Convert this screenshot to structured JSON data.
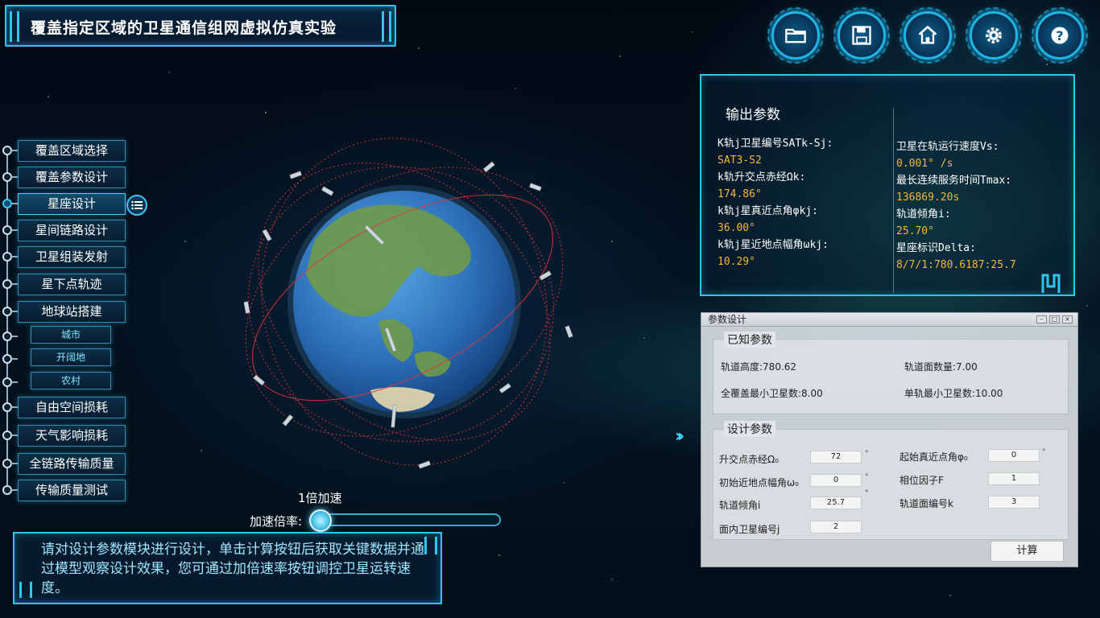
{
  "app": {
    "title": "覆盖指定区域的卫星通信组网虚拟仿真实验"
  },
  "toolbar": {
    "buttons": [
      {
        "name": "open-folder-button",
        "icon": "folder-icon"
      },
      {
        "name": "save-button",
        "icon": "save-icon"
      },
      {
        "name": "home-button",
        "icon": "home-icon"
      },
      {
        "name": "settings-button",
        "icon": "gear-icon"
      },
      {
        "name": "help-button",
        "icon": "help-icon"
      }
    ]
  },
  "menu": {
    "items": [
      {
        "label": "覆盖区域选择"
      },
      {
        "label": "覆盖参数设计"
      },
      {
        "label": "星座设计",
        "active": true
      },
      {
        "label": "星间链路设计"
      },
      {
        "label": "卫星组装发射"
      },
      {
        "label": "星下点轨迹"
      },
      {
        "label": "地球站搭建"
      },
      {
        "label": "城市",
        "sub": true
      },
      {
        "label": "开阔地",
        "sub": true
      },
      {
        "label": "农村",
        "sub": true
      },
      {
        "label": "自由空间损耗"
      },
      {
        "label": "天气影响损耗"
      },
      {
        "label": "全链路传输质量"
      },
      {
        "label": "传输质量测试"
      }
    ]
  },
  "speed": {
    "caption": "1倍加速",
    "label": "加速倍率:",
    "level": 0.0
  },
  "hint": {
    "text": "请对设计参数模块进行设计，单击计算按钮后获取关键数据并通过模型观察设计效果，您可通过加倍速率按钮调控卫星运转速度。"
  },
  "output": {
    "title": "输出参数",
    "left": [
      {
        "label": "K轨j卫星编号SATk-Sj:",
        "value": "SAT3-S2"
      },
      {
        "label": "k轨升交点赤经Ωk:",
        "value": "174.86°"
      },
      {
        "label": "k轨j星真近点角φkj:",
        "value": "36.00°"
      },
      {
        "label": "k轨j星近地点幅角ωkj:",
        "value": "10.29°"
      }
    ],
    "right": [
      {
        "label": "卫星在轨运行速度Vs:",
        "value": "0.001° /s"
      },
      {
        "label": "最长连续服务时间Tmax:",
        "value": "136869.20s"
      },
      {
        "label": "轨道倾角i:",
        "value": "25.70°"
      },
      {
        "label": "星座标识Delta:",
        "value": "8/7/1:780.6187:25.7"
      }
    ]
  },
  "design": {
    "window_title": "参数设计",
    "known": {
      "title": "已知参数",
      "orbit_height": "轨道高度:780.62",
      "orbit_planes": "轨道面数量:7.00",
      "min_sats_total": "全覆盖最小卫星数:8.00",
      "min_sats_per_orbit": "单轨最小卫星数:10.00"
    },
    "params": {
      "title": "设计参数",
      "raan_label": "升交点赤经Ω₀",
      "raan_value": "72",
      "start_anomaly_label": "起始真近点角φ₀",
      "start_anomaly_value": "0",
      "perigee_label": "初始近地点幅角ω₀",
      "perigee_value": "0",
      "phase_label": "相位因子F",
      "phase_value": "1",
      "incl_label": "轨道倾角i",
      "incl_value": "25.7",
      "plane_no_label": "轨道面编号k",
      "plane_no_value": "3",
      "sat_no_label": "面内卫星编号j",
      "sat_no_value": "2",
      "deg": "°"
    },
    "calc_label": "计算"
  },
  "colors": {
    "accent": "#2ec6f0",
    "value": "#f5b73b",
    "orbit": "#e0353a"
  }
}
